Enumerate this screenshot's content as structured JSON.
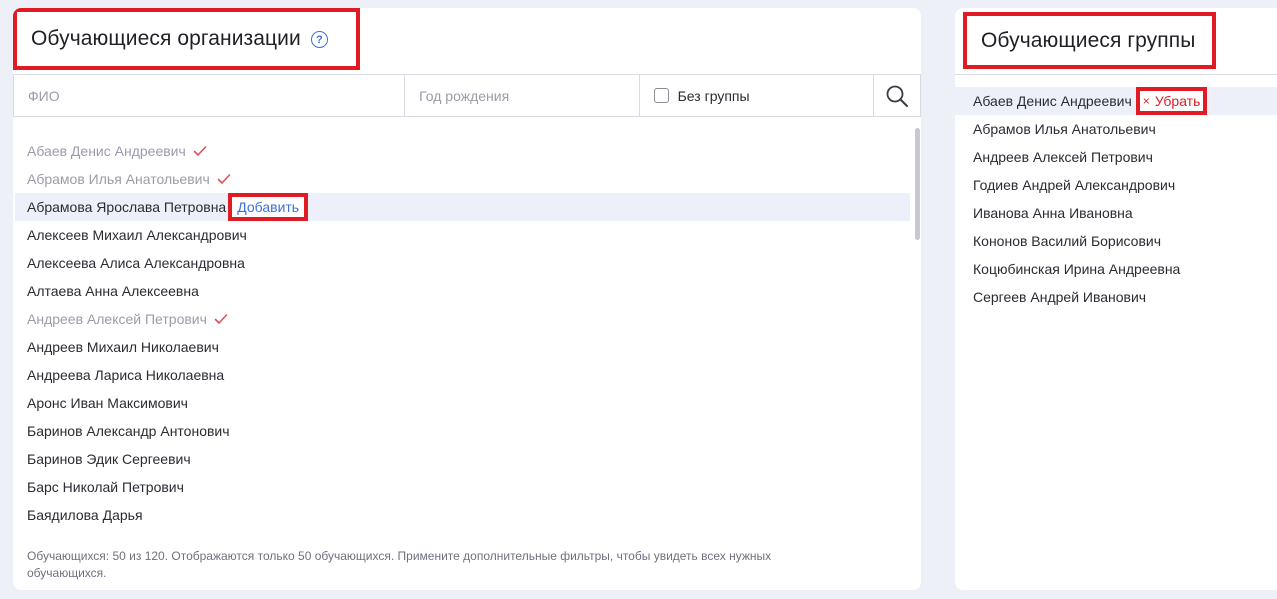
{
  "left_panel": {
    "title": "Обучающиеся организации",
    "help_icon": "question-circle-icon",
    "filters": {
      "fio_placeholder": "ФИО",
      "year_placeholder": "Год рождения",
      "no_group_label": "Без группы",
      "search_icon": "search-icon"
    },
    "add_label": "Добавить",
    "students": [
      {
        "name": "Абаев Денис Андреевич",
        "added": true
      },
      {
        "name": "Абрамов Илья Анатольевич",
        "added": true
      },
      {
        "name": "Абрамова Ярослава Петровна",
        "added": false,
        "hovered": true
      },
      {
        "name": "Алексеев Михаил Александрович",
        "added": false
      },
      {
        "name": "Алексеева Алиса Александровна",
        "added": false
      },
      {
        "name": "Алтаева Анна Алексеевна",
        "added": false
      },
      {
        "name": "Андреев Алексей Петрович",
        "added": true
      },
      {
        "name": "Андреев Михаил Николаевич",
        "added": false
      },
      {
        "name": "Андреева Лариса Николаевна",
        "added": false
      },
      {
        "name": "Аронс Иван Максимович",
        "added": false
      },
      {
        "name": "Баринов Александр Антонович",
        "added": false
      },
      {
        "name": "Баринов Эдик Сергеевич",
        "added": false
      },
      {
        "name": "Барс Николай Петрович",
        "added": false
      },
      {
        "name": "Баядилова Дарья",
        "added": false
      }
    ],
    "footer_note": "Обучающихся: 50 из 120. Отображаются только 50 обучающихся. Примените дополнительные фильтры, чтобы увидеть всех нужных обучающихся."
  },
  "right_panel": {
    "title": "Обучающиеся группы",
    "remove_label": "Убрать",
    "remove_x": "×",
    "members": [
      {
        "name": "Абаев Денис Андреевич",
        "hovered": true
      },
      {
        "name": "Абрамов Илья Анатольевич"
      },
      {
        "name": "Андреев Алексей Петрович"
      },
      {
        "name": "Годиев Андрей Александрович"
      },
      {
        "name": "Иванова Анна Ивановна"
      },
      {
        "name": "Кононов Василий Борисович"
      },
      {
        "name": "Коцюбинская Ирина Андреевна"
      },
      {
        "name": "Сергеев Андрей Иванович"
      }
    ]
  },
  "colors": {
    "accent_blue": "#3d6fe0",
    "annotation_red": "#e01b24",
    "check_red": "#e0505a",
    "muted_text": "#9a9cab"
  }
}
